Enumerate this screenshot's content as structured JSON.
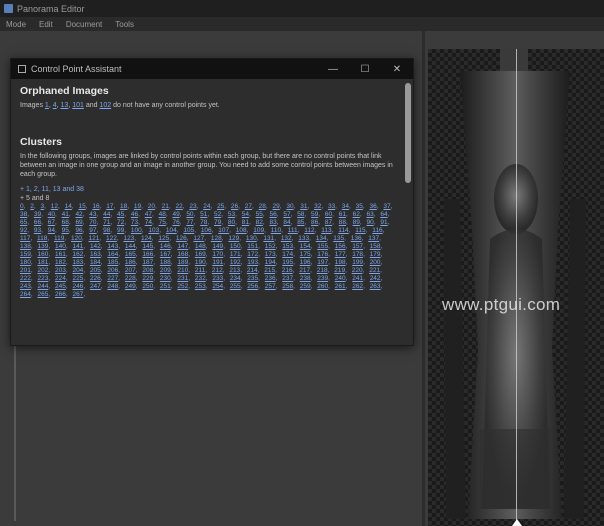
{
  "app": {
    "title": "Panorama Editor",
    "menu": [
      "Mode",
      "Edit",
      "Document",
      "Tools"
    ]
  },
  "preview": {
    "watermark": "www.ptgui.com"
  },
  "dialog": {
    "title": "Control Point Assistant",
    "controls": [
      "—",
      "☐",
      "✕"
    ],
    "orphaned": {
      "heading": "Orphaned Images",
      "text_prefix": "Images",
      "links": [
        "1",
        "4",
        "13",
        "101",
        "102"
      ],
      "text_suffix": "do not have any control points yet."
    },
    "clusters": {
      "heading": "Clusters",
      "description": "In the following groups, images are linked by control points within each group, but there are no control points that link between an image in one group and an image in another group. You need to add some control points between images in each group.",
      "group_a": "+ 1, 2, 11, 13 and 38",
      "group_b": "+ 5 and 8",
      "images": [
        "0",
        "2",
        "3",
        "12",
        "14",
        "15",
        "16",
        "17",
        "18",
        "19",
        "20",
        "21",
        "22",
        "23",
        "24",
        "25",
        "26",
        "27",
        "28",
        "29",
        "30",
        "31",
        "32",
        "33",
        "34",
        "35",
        "36",
        "37",
        "38",
        "39",
        "40",
        "41",
        "42",
        "43",
        "44",
        "45",
        "46",
        "47",
        "48",
        "49",
        "50",
        "51",
        "52",
        "53",
        "54",
        "55",
        "56",
        "57",
        "58",
        "59",
        "60",
        "61",
        "62",
        "63",
        "64",
        "65",
        "66",
        "67",
        "68",
        "69",
        "70",
        "71",
        "72",
        "73",
        "74",
        "75",
        "76",
        "77",
        "78",
        "79",
        "80",
        "81",
        "82",
        "83",
        "84",
        "85",
        "86",
        "87",
        "88",
        "89",
        "90",
        "91",
        "92",
        "93",
        "94",
        "95",
        "96",
        "97",
        "98",
        "99",
        "100",
        "103",
        "104",
        "105",
        "106",
        "107",
        "108",
        "109",
        "110",
        "111",
        "112",
        "113",
        "114",
        "115",
        "116",
        "117",
        "118",
        "119",
        "120",
        "121",
        "122",
        "123",
        "124",
        "125",
        "126",
        "127",
        "128",
        "129",
        "130",
        "131",
        "132",
        "133",
        "134",
        "135",
        "136",
        "137",
        "138",
        "139",
        "140",
        "141",
        "142",
        "143",
        "144",
        "145",
        "146",
        "147",
        "148",
        "149",
        "150",
        "151",
        "152",
        "153",
        "154",
        "155",
        "156",
        "157",
        "158",
        "159",
        "160",
        "161",
        "162",
        "163",
        "164",
        "165",
        "166",
        "167",
        "168",
        "169",
        "170",
        "171",
        "172",
        "173",
        "174",
        "175",
        "176",
        "177",
        "178",
        "179",
        "180",
        "181",
        "182",
        "183",
        "184",
        "185",
        "186",
        "187",
        "188",
        "189",
        "190",
        "191",
        "192",
        "193",
        "194",
        "195",
        "196",
        "197",
        "198",
        "199",
        "200",
        "201",
        "202",
        "203",
        "204",
        "205",
        "206",
        "207",
        "208",
        "209",
        "210",
        "211",
        "212",
        "213",
        "214",
        "215",
        "216",
        "217",
        "218",
        "219",
        "220",
        "221",
        "222",
        "223",
        "224",
        "225",
        "226",
        "227",
        "228",
        "229",
        "230",
        "231",
        "232",
        "233",
        "234",
        "235",
        "236",
        "237",
        "238",
        "239",
        "240",
        "241",
        "242",
        "243",
        "244",
        "245",
        "246",
        "247",
        "248",
        "249",
        "250",
        "251",
        "252",
        "253",
        "254",
        "255",
        "256",
        "257",
        "258",
        "259",
        "260",
        "261",
        "262",
        "263",
        "264",
        "265",
        "266",
        "267"
      ]
    }
  }
}
